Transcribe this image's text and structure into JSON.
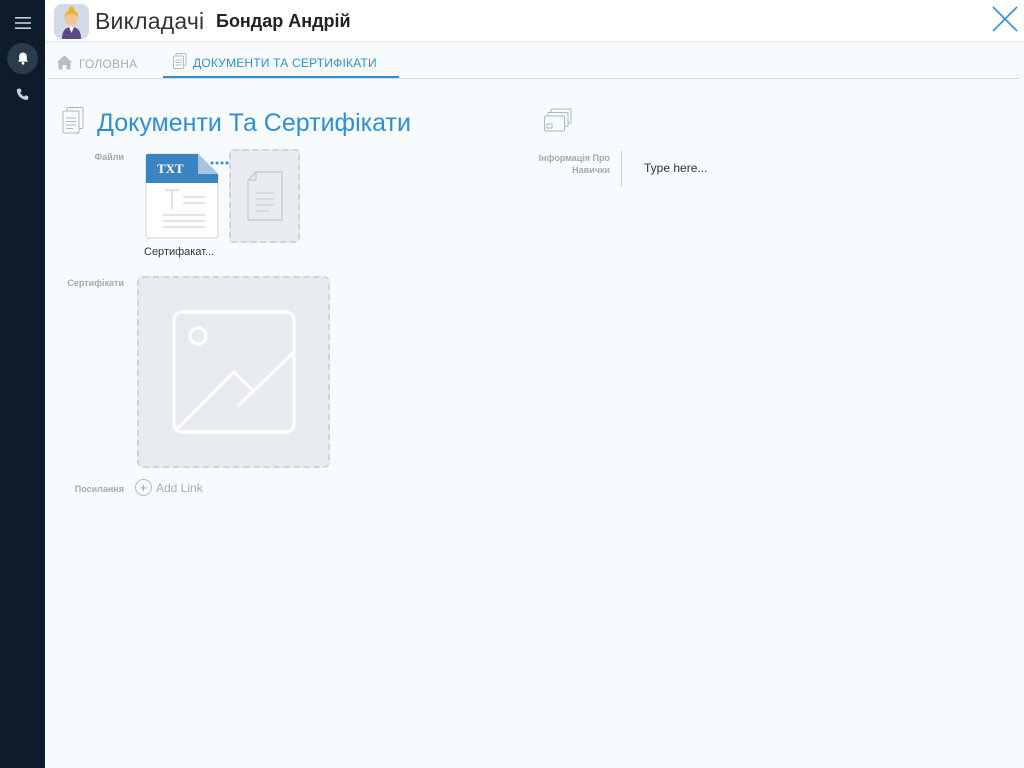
{
  "header": {
    "app_title": "Викладачі",
    "record_title": "Бондар Андрій"
  },
  "tabs": [
    {
      "label": "ГОЛОВНА",
      "icon": "home-icon"
    },
    {
      "label": "ДОКУМЕНТИ ТА СЕРТИФІКАТИ",
      "icon": "document-icon",
      "active": true
    }
  ],
  "section": {
    "title": "Документи Та Сертифікати"
  },
  "files": {
    "label": "Файли",
    "items": [
      {
        "type": "TXT",
        "name": "Сертифакат..."
      }
    ]
  },
  "certificates": {
    "label": "Сертифікати"
  },
  "links": {
    "label": "Посилання",
    "add_label": "Add Link"
  },
  "skills": {
    "label": "Інформація Про Навички",
    "placeholder": "Type here..."
  },
  "colors": {
    "accent": "#2e8fd9",
    "rail": "#0d1b2a"
  }
}
